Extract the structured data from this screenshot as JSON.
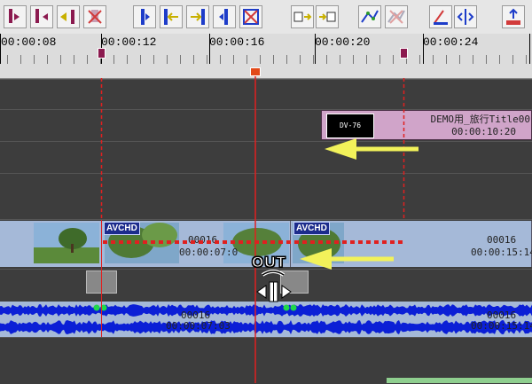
{
  "timeline": {
    "labels": [
      "00:00:08",
      "00:00:12",
      "00:00:16",
      "00:00:20",
      "00:00:24"
    ]
  },
  "title_clip": {
    "thumb_text": "DV-76",
    "name": "DEMO用_旅行Title00",
    "time": "00:00:10:20"
  },
  "video_clips": [
    {
      "badge": "AVCHD",
      "num": "00016",
      "time": "00:00:07:0"
    },
    {
      "badge": "AVCHD",
      "num": "00016",
      "time": "00:00:15:14"
    }
  ],
  "audio": {
    "num1": "00016",
    "time1": "00:00:07:03",
    "num2": "00016",
    "time2": "00:00:15:14"
  },
  "cursor": {
    "label": "OUT"
  },
  "colors": {
    "playhead": "#e02020",
    "marker_line": "#e02020",
    "arrow": "#f2f25a",
    "title_clip": "#d0a4c9",
    "video_clip": "#a5b9d8",
    "waveform": "#0b1fd6"
  }
}
